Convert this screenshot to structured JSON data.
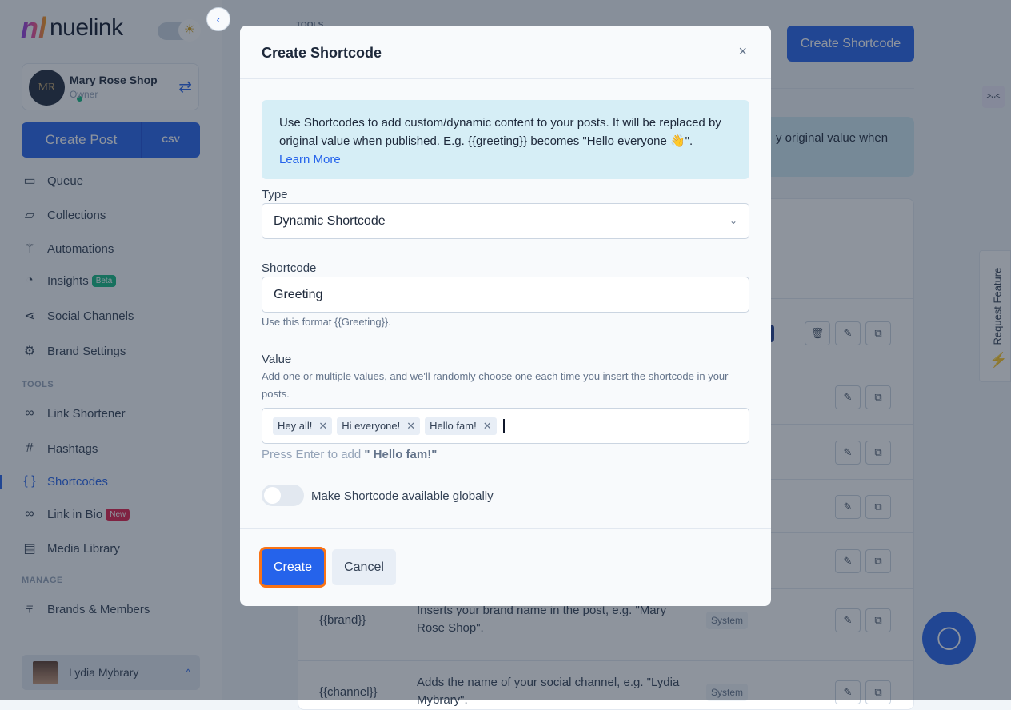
{
  "sidebar": {
    "logo_mark": "nl",
    "logo_text": "nuelink",
    "brand": {
      "name": "Mary Rose Shop",
      "role": "Owner",
      "avatar_text": "MR"
    },
    "create_post": "Create Post",
    "csv": "CSV",
    "items": [
      {
        "label": "Queue",
        "icon": "calendar-icon"
      },
      {
        "label": "Collections",
        "icon": "folder-icon"
      },
      {
        "label": "Automations",
        "icon": "magic-wand-icon"
      },
      {
        "label": "Insights",
        "icon": "pie-chart-icon",
        "badge": "Beta"
      },
      {
        "label": "Social Channels",
        "icon": "share-icon"
      },
      {
        "label": "Brand Settings",
        "icon": "gear-icon"
      }
    ],
    "tools_label": "TOOLS",
    "tools": [
      {
        "label": "Link Shortener",
        "icon": "link-icon"
      },
      {
        "label": "Hashtags",
        "icon": "hash-icon"
      },
      {
        "label": "Shortcodes",
        "icon": "braces-icon",
        "active": true
      },
      {
        "label": "Link in Bio",
        "icon": "link-icon",
        "badge": "New"
      },
      {
        "label": "Media Library",
        "icon": "images-icon"
      }
    ],
    "manage_label": "MANAGE",
    "manage": [
      {
        "label": "Brands & Members",
        "icon": "sliders-icon"
      }
    ],
    "user": "Lydia Mybrary"
  },
  "main": {
    "section": "TOOLS",
    "create_shortcode": "Create Shortcode",
    "alert_tail": "y original value when",
    "tag_partial": "de",
    "rows": [
      {
        "code": "{{brand}}",
        "desc": "Inserts your brand name in the post, e.g. \"Mary Rose Shop\".",
        "type": "System"
      },
      {
        "code": "{{channel}}",
        "desc": "Adds the name of your social channel, e.g. \"Lydia Mybrary\".",
        "type": "System"
      }
    ]
  },
  "widgets": {
    "request_feature": "Request Feature",
    "face": ">ᴗ<"
  },
  "modal": {
    "title": "Create Shortcode",
    "info": "Use Shortcodes to add custom/dynamic content to your posts. It will be replaced by original value when published. E.g. {{greeting}} becomes \"Hello everyone 👋\".",
    "learn_more": "Learn More",
    "type_label": "Type",
    "type_value": "Dynamic Shortcode",
    "shortcode_label": "Shortcode",
    "shortcode_value": "Greeting",
    "shortcode_help": "Use this format {{Greeting}}.",
    "value_label": "Value",
    "value_help": "Add one or multiple values, and we'll randomly choose one each time you insert the shortcode in your posts.",
    "tags": [
      "Hey all!",
      "Hi everyone!",
      "Hello fam!"
    ],
    "press_prefix": "Press Enter to add",
    "press_value": "\" Hello fam!\"",
    "global_label": "Make Shortcode available globally",
    "global_on": false,
    "create": "Create",
    "cancel": "Cancel"
  },
  "colors": {
    "accent": "#2563eb",
    "beta": "#10b981",
    "new": "#e11d48",
    "focus_ring": "#f97316"
  }
}
